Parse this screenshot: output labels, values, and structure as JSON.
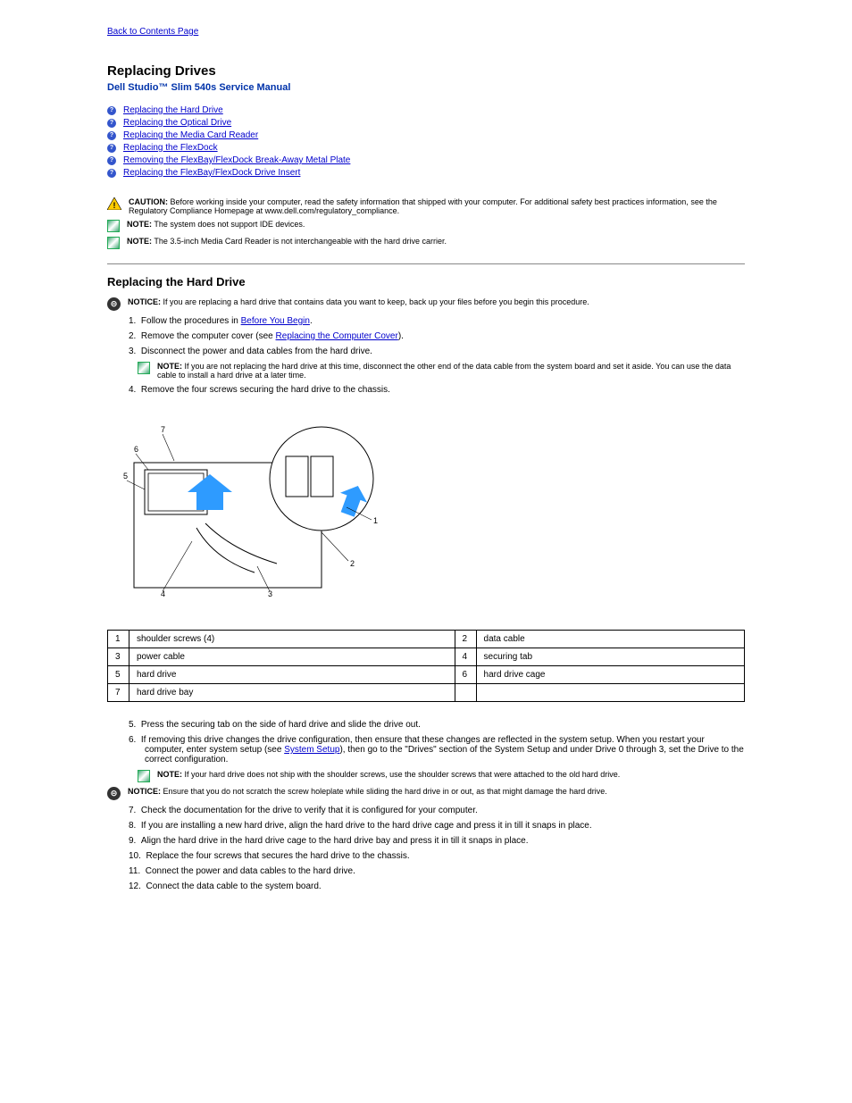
{
  "topLink": "Back to Contents Page",
  "pageTitle": "Replacing Drives",
  "subtitle": "Dell Studio™ Slim 540s Service Manual",
  "toc": [
    "Replacing the Hard Drive",
    "Replacing the Optical Drive",
    "Replacing the Media Card Reader",
    "Replacing the FlexDock",
    "Removing the FlexBay/FlexDock Break-Away Metal Plate",
    "Replacing the FlexBay/FlexDock Drive Insert"
  ],
  "caution": {
    "label": "CAUTION:",
    "text": "Before working inside your computer, read the safety information that shipped with your computer. For additional safety best practices information, see the Regulatory Compliance Homepage at www.dell.com/regulatory_compliance."
  },
  "note1": {
    "label": "NOTE:",
    "text": "The system does not support IDE devices."
  },
  "note2": {
    "label": "NOTE:",
    "text": "The 3.5-inch Media Card Reader is not interchangeable with the hard drive carrier."
  },
  "section1": {
    "title": "Replacing the Hard Drive",
    "notice": {
      "label": "NOTICE:",
      "text": "If you are replacing a hard drive that contains data you want to keep, back up your files before you begin this procedure."
    },
    "steps": [
      {
        "n": "1.",
        "text": "Follow the procedures in ",
        "link": "Before You Begin",
        "after": "."
      },
      {
        "n": "2.",
        "text": "Remove the computer cover (see ",
        "link": "Replacing the Computer Cover",
        "after": ")."
      },
      {
        "n": "3.",
        "text": "Disconnect the power and data cables from the hard drive."
      }
    ],
    "stepNote": {
      "label": "NOTE:",
      "text": "If you are not replacing the hard drive at this time, disconnect the other end of the data cable from the system board and set it aside. You can use the data cable to install a hard drive at a later time."
    },
    "steps2": [
      {
        "n": "4.",
        "text": "Remove the four screws securing the hard drive to the chassis."
      }
    ]
  },
  "partsTable": [
    [
      "1",
      "shoulder screws (4)",
      "2",
      "data cable"
    ],
    [
      "3",
      "power cable",
      "4",
      "securing tab"
    ],
    [
      "5",
      "hard drive",
      "6",
      "hard drive cage"
    ],
    [
      "7",
      "hard drive bay",
      "",
      ""
    ]
  ],
  "steps3": [
    {
      "n": "5.",
      "text": "Press the securing tab on the side of hard drive and slide the drive out."
    },
    {
      "n": "6.",
      "text": "If removing this drive changes the drive configuration, then ensure that these changes are reflected in the system setup. When you restart your computer, enter system setup (see ",
      "link": "System Setup",
      "after": "), then go to the \"Drives\" section of the System Setup and under Drive 0 through 3, set the Drive to the correct configuration."
    }
  ],
  "notice2": {
    "label": "NOTICE:",
    "text": "Ensure that you do not scratch the screw holeplate while sliding the hard drive in or out, as that might damage the hard drive."
  },
  "steps4": [
    {
      "n": "7.",
      "text": "Check the documentation for the drive to verify that it is configured for your computer."
    },
    {
      "n": "8.",
      "text": "If you are installing a new hard drive, align the hard drive to the hard drive cage and press it in till it snaps in place."
    },
    {
      "n": "9.",
      "text": "Align the hard drive in the hard drive cage to the hard drive bay and press it in till it snaps in place."
    },
    {
      "n": "10.",
      "text": "Replace the four screws that secures the hard drive to the chassis."
    },
    {
      "n": "11.",
      "text": "Connect the power and data cables to the hard drive."
    },
    {
      "n": "12.",
      "text": "Connect the data cable to the system board."
    }
  ],
  "noteIndented": {
    "label": "NOTE:",
    "text": "If your hard drive does not ship with the shoulder screws, use the shoulder screws that were attached to the old hard drive."
  }
}
